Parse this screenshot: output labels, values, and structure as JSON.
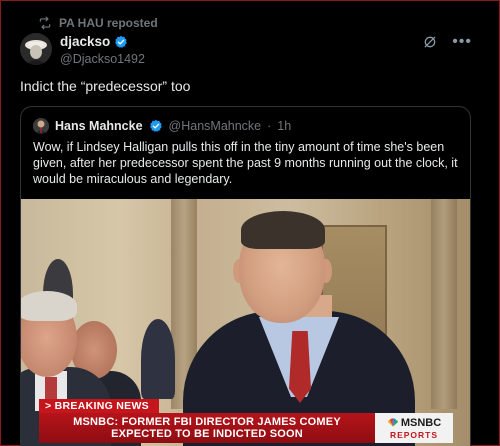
{
  "repost": {
    "label": "PA HAU reposted"
  },
  "author": {
    "name": "djackso",
    "handle": "@Djackso1492"
  },
  "post": {
    "text": "Indict the “predecessor” too"
  },
  "quote": {
    "name": "Hans Mahncke",
    "handle": "@HansMahncke",
    "separator": "·",
    "time": "1h",
    "text": "Wow, if Lindsey Halligan pulls this off in the tiny amount of time she's been given, after her predecessor spent the past 9 months running out the clock, it would be miraculous and legendary."
  },
  "media": {
    "breaking_label": "> BREAKING NEWS",
    "banner_line1": "MSNBC: FORMER FBI DIRECTOR JAMES COMEY",
    "banner_line2": "EXPECTED TO BE INDICTED SOON",
    "network": "MSNBC",
    "network_sub": "REPORTS"
  },
  "colors": {
    "background": "#000000",
    "text": "#e7e9ea",
    "muted": "#71767b",
    "verified": "#1d9bf0",
    "breaking_red": "#c4161c"
  },
  "icons": {
    "repost": "repost-icon",
    "verified": "verified-badge-icon",
    "grok": "grok-icon",
    "more": "more-icon",
    "network_logo": "peacock-icon"
  }
}
